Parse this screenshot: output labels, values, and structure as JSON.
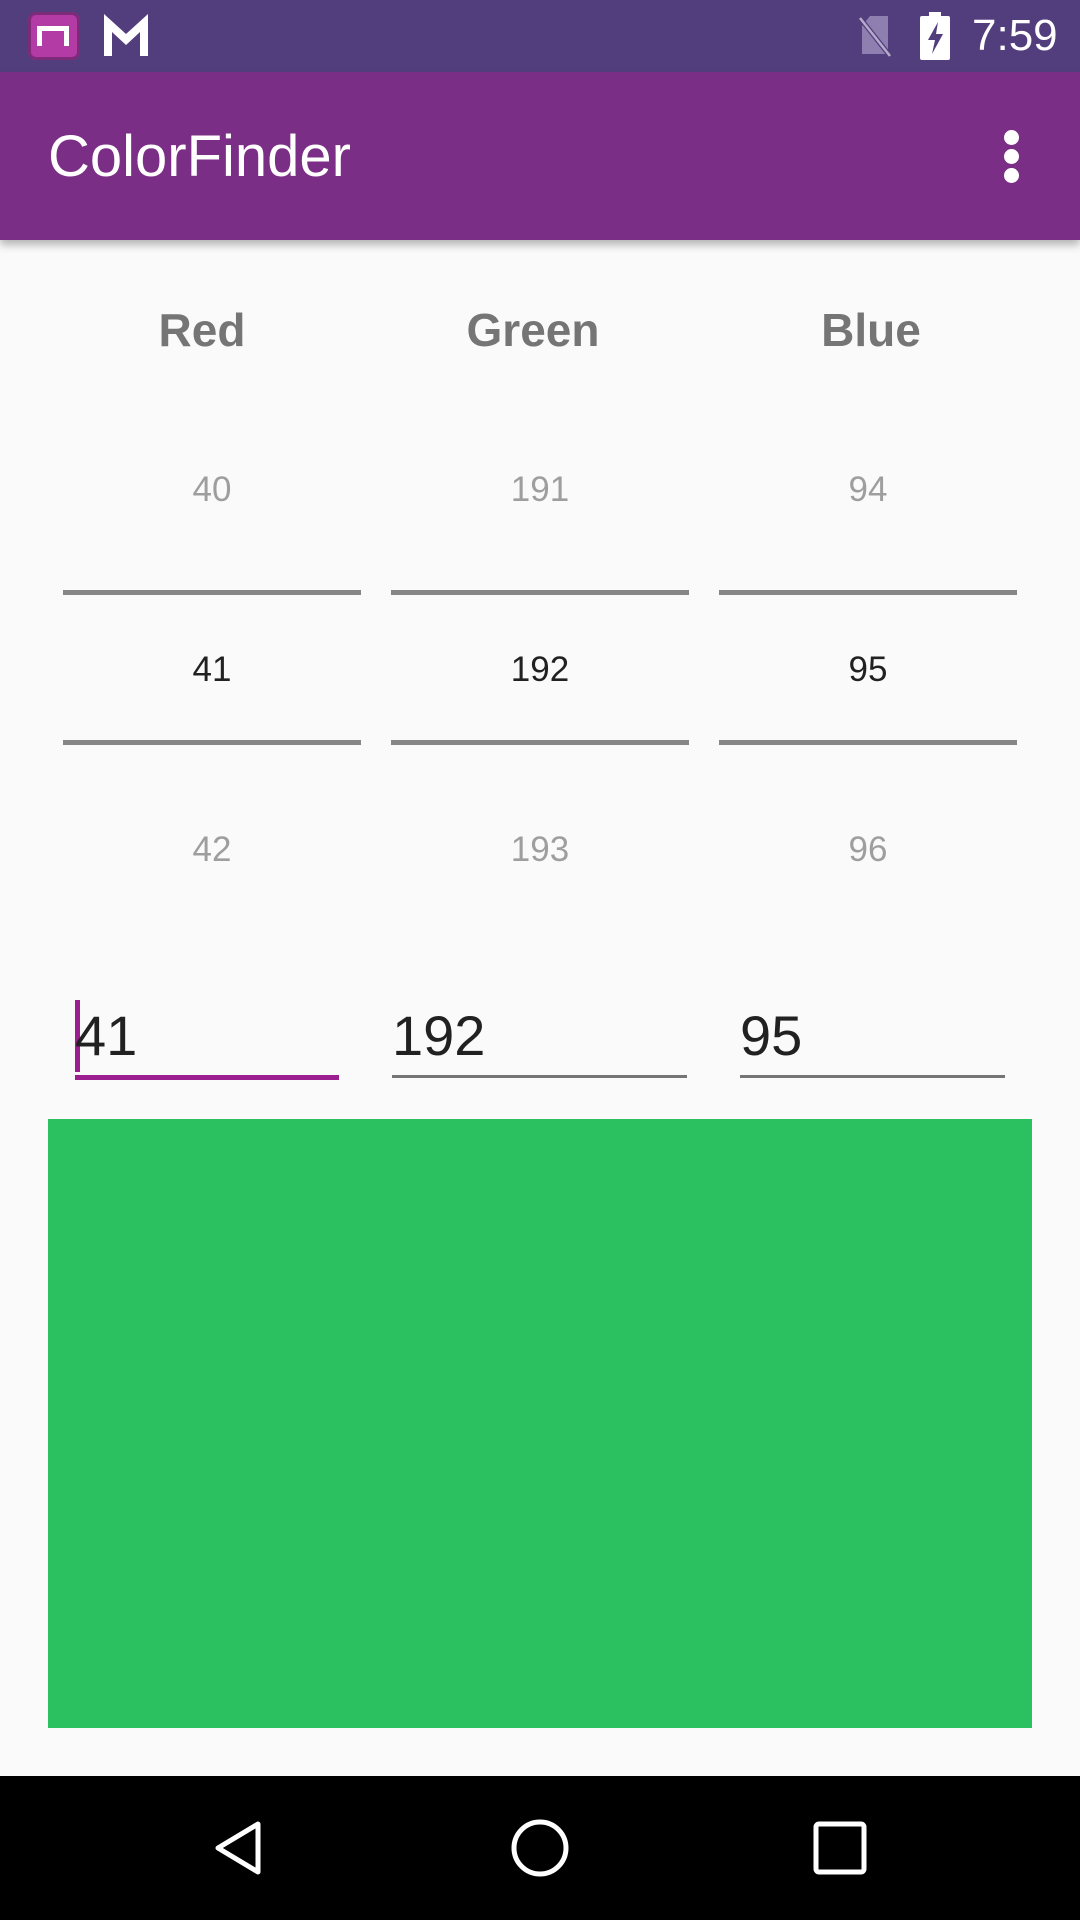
{
  "status_bar": {
    "time": "7:59",
    "icons": [
      "app-notification-icon",
      "gmail-icon",
      "no-sim-icon",
      "battery-charging-icon"
    ]
  },
  "app_bar": {
    "title": "ColorFinder",
    "overflow_icon": "more-vert-icon"
  },
  "pickers": [
    {
      "label": "Red",
      "prev": "40",
      "value": "41",
      "next": "42"
    },
    {
      "label": "Green",
      "prev": "191",
      "value": "192",
      "next": "193"
    },
    {
      "label": "Blue",
      "prev": "94",
      "value": "95",
      "next": "96"
    }
  ],
  "inputs": {
    "red": "41",
    "green": "192",
    "blue": "95"
  },
  "preview": {
    "color": "#2bc060"
  },
  "colors": {
    "status_bar": "#523e7c",
    "app_bar": "#7b2e85",
    "accent": "#9c1f8f"
  },
  "nav_bar": {
    "icons": [
      "back-icon",
      "home-icon",
      "recents-icon"
    ]
  }
}
